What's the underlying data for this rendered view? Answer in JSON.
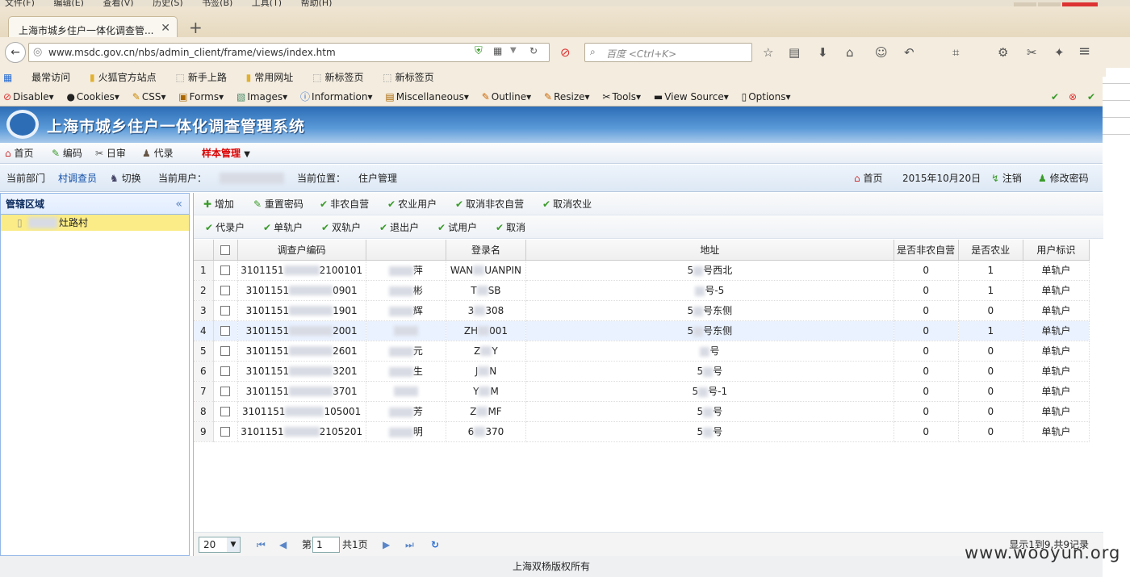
{
  "browser": {
    "menu": [
      "文件(F)",
      "编辑(E)",
      "查看(V)",
      "历史(S)",
      "书签(B)",
      "工具(T)",
      "帮助(H)"
    ],
    "tab_title": "上海市城乡住户一体化调查管...",
    "url": "www.msdc.gov.cn/nbs/admin_client/frame/views/index.htm",
    "search_placeholder": "百度 <Ctrl+K>",
    "bookmarks": [
      "最常访问",
      "火狐官方站点",
      "新手上路",
      "常用网址",
      "新标签页",
      "新标签页"
    ],
    "webdev": [
      "Disable▾",
      "Cookies▾",
      "CSS▾",
      "Forms▾",
      "Images▾",
      "Information▾",
      "Miscellaneous▾",
      "Outline▾",
      "Resize▾",
      "Tools▾",
      "View Source▾",
      "Options▾"
    ]
  },
  "app": {
    "title": "上海市城乡住户一体化调查管理系统",
    "menu": {
      "home": "首页",
      "code": "编码",
      "daily": "日审",
      "record": "代录",
      "sample": "样本管理"
    },
    "info": {
      "dept_label": "当前部门",
      "dept_value": "村调查员",
      "switch": "切换",
      "user_label": "当前用户：",
      "location_label": "当前位置：",
      "location_value": "住户管理",
      "home": "首页",
      "date": "2015年10月20日",
      "logout": "注销",
      "change_pwd": "修改密码"
    },
    "side": {
      "header": "管辖区域",
      "village": "灶路村"
    },
    "toolbar1": [
      "增加",
      "重置密码",
      "非农自营",
      "农业用户",
      "取消非农自营",
      "取消农业"
    ],
    "toolbar2": [
      "代录户",
      "单轨户",
      "双轨户",
      "退出户",
      "试用户",
      "取消"
    ],
    "columns": [
      "调查户编码",
      "",
      "登录名",
      "地址",
      "是否非农自营",
      "是否农业",
      "用户标识"
    ],
    "rows": [
      {
        "n": "1",
        "code_a": "3101151",
        "code_b": "2100101",
        "name": "萍",
        "login": "WAN",
        "login2": "UANPIN",
        "addr": "5",
        "addr2": "号西北",
        "nonfarm": "0",
        "farm": "1",
        "tag": "单轨户"
      },
      {
        "n": "2",
        "code_a": "3101151",
        "code_b": "0901",
        "name": "彬",
        "login": "T",
        "login2": "SB",
        "addr": "",
        "addr2": "号-5",
        "nonfarm": "0",
        "farm": "1",
        "tag": "单轨户"
      },
      {
        "n": "3",
        "code_a": "3101151",
        "code_b": "1901",
        "name": "辉",
        "login": "3",
        "login2": "308",
        "addr": "5",
        "addr2": "号东侧",
        "nonfarm": "0",
        "farm": "0",
        "tag": "单轨户"
      },
      {
        "n": "4",
        "code_a": "3101151",
        "code_b": "2001",
        "name": "",
        "login": "ZH",
        "login2": "001",
        "addr": "5",
        "addr2": "号东侧",
        "nonfarm": "0",
        "farm": "1",
        "tag": "单轨户"
      },
      {
        "n": "5",
        "code_a": "3101151",
        "code_b": "2601",
        "name": "元",
        "login": "Z",
        "login2": "Y",
        "addr": "",
        "addr2": "号",
        "nonfarm": "0",
        "farm": "0",
        "tag": "单轨户"
      },
      {
        "n": "6",
        "code_a": "3101151",
        "code_b": "3201",
        "name": "生",
        "login": "J",
        "login2": "N",
        "addr": "5",
        "addr2": "号",
        "nonfarm": "0",
        "farm": "0",
        "tag": "单轨户"
      },
      {
        "n": "7",
        "code_a": "3101151",
        "code_b": "3701",
        "name": "",
        "login": "Y",
        "login2": "M",
        "addr": "5",
        "addr2": "号-1",
        "nonfarm": "0",
        "farm": "0",
        "tag": "单轨户"
      },
      {
        "n": "8",
        "code_a": "3101151",
        "code_b": "105001",
        "name": "芳",
        "login": "Z",
        "login2": "MF",
        "addr": "5",
        "addr2": "号",
        "nonfarm": "0",
        "farm": "0",
        "tag": "单轨户"
      },
      {
        "n": "9",
        "code_a": "3101151",
        "code_b": "2105201",
        "name": "明",
        "login": "6",
        "login2": "370",
        "addr": "5",
        "addr2": "号",
        "nonfarm": "0",
        "farm": "0",
        "tag": "单轨户"
      }
    ],
    "pager": {
      "size": "20",
      "page_prefix": "第",
      "page": "1",
      "total": "共1页",
      "summary": "显示1到9,共9记录"
    },
    "footer": "上海双杨版权所有"
  },
  "watermark": "www.wooyun.org"
}
